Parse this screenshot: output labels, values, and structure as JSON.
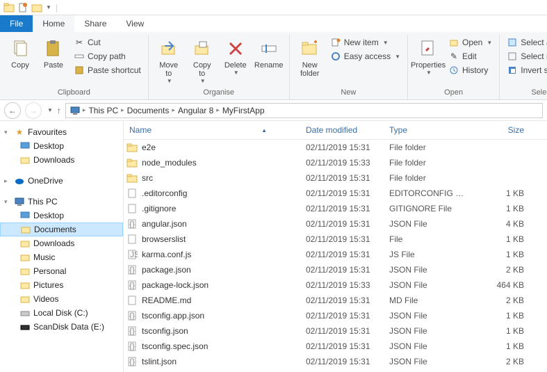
{
  "tabs": {
    "file": "File",
    "home": "Home",
    "share": "Share",
    "view": "View"
  },
  "ribbon": {
    "clipboard": {
      "label": "Clipboard",
      "copy": "Copy",
      "paste": "Paste",
      "cut": "Cut",
      "copy_path": "Copy path",
      "paste_shortcut": "Paste shortcut"
    },
    "organise": {
      "label": "Organise",
      "move_to": "Move\nto",
      "copy_to": "Copy\nto",
      "delete": "Delete",
      "rename": "Rename"
    },
    "new": {
      "label": "New",
      "new_folder": "New\nfolder",
      "new_item": "New item",
      "easy_access": "Easy access"
    },
    "open": {
      "label": "Open",
      "properties": "Properties",
      "open": "Open",
      "edit": "Edit",
      "history": "History"
    },
    "select": {
      "label": "Select",
      "select_all": "Select all",
      "select_none": "Select none",
      "invert": "Invert selection"
    }
  },
  "breadcrumb": [
    "This PC",
    "Documents",
    "Angular 8",
    "MyFirstApp"
  ],
  "tree": {
    "favourites": {
      "label": "Favourites",
      "items": [
        "Desktop",
        "Downloads"
      ]
    },
    "onedrive": "OneDrive",
    "thispc": {
      "label": "This PC",
      "items": [
        "Desktop",
        "Documents",
        "Downloads",
        "Music",
        "Personal",
        "Pictures",
        "Videos",
        "Local Disk (C:)",
        "ScanDisk Data (E:)"
      ]
    }
  },
  "columns": {
    "name": "Name",
    "date": "Date modified",
    "type": "Type",
    "size": "Size"
  },
  "files": [
    {
      "name": "e2e",
      "date": "02/11/2019 15:31",
      "type": "File folder",
      "size": "",
      "icon": "folder"
    },
    {
      "name": "node_modules",
      "date": "02/11/2019 15:33",
      "type": "File folder",
      "size": "",
      "icon": "folder"
    },
    {
      "name": "src",
      "date": "02/11/2019 15:31",
      "type": "File folder",
      "size": "",
      "icon": "folder"
    },
    {
      "name": ".editorconfig",
      "date": "02/11/2019 15:31",
      "type": "EDITORCONFIG File",
      "size": "1 KB",
      "icon": "file"
    },
    {
      "name": ".gitignore",
      "date": "02/11/2019 15:31",
      "type": "GITIGNORE File",
      "size": "1 KB",
      "icon": "file"
    },
    {
      "name": "angular.json",
      "date": "02/11/2019 15:31",
      "type": "JSON File",
      "size": "4 KB",
      "icon": "json"
    },
    {
      "name": "browserslist",
      "date": "02/11/2019 15:31",
      "type": "File",
      "size": "1 KB",
      "icon": "file"
    },
    {
      "name": "karma.conf.js",
      "date": "02/11/2019 15:31",
      "type": "JS File",
      "size": "1 KB",
      "icon": "js"
    },
    {
      "name": "package.json",
      "date": "02/11/2019 15:31",
      "type": "JSON File",
      "size": "2 KB",
      "icon": "json"
    },
    {
      "name": "package-lock.json",
      "date": "02/11/2019 15:33",
      "type": "JSON File",
      "size": "464 KB",
      "icon": "json"
    },
    {
      "name": "README.md",
      "date": "02/11/2019 15:31",
      "type": "MD File",
      "size": "2 KB",
      "icon": "file"
    },
    {
      "name": "tsconfig.app.json",
      "date": "02/11/2019 15:31",
      "type": "JSON File",
      "size": "1 KB",
      "icon": "json"
    },
    {
      "name": "tsconfig.json",
      "date": "02/11/2019 15:31",
      "type": "JSON File",
      "size": "1 KB",
      "icon": "json"
    },
    {
      "name": "tsconfig.spec.json",
      "date": "02/11/2019 15:31",
      "type": "JSON File",
      "size": "1 KB",
      "icon": "json"
    },
    {
      "name": "tslint.json",
      "date": "02/11/2019 15:31",
      "type": "JSON File",
      "size": "2 KB",
      "icon": "json"
    }
  ]
}
